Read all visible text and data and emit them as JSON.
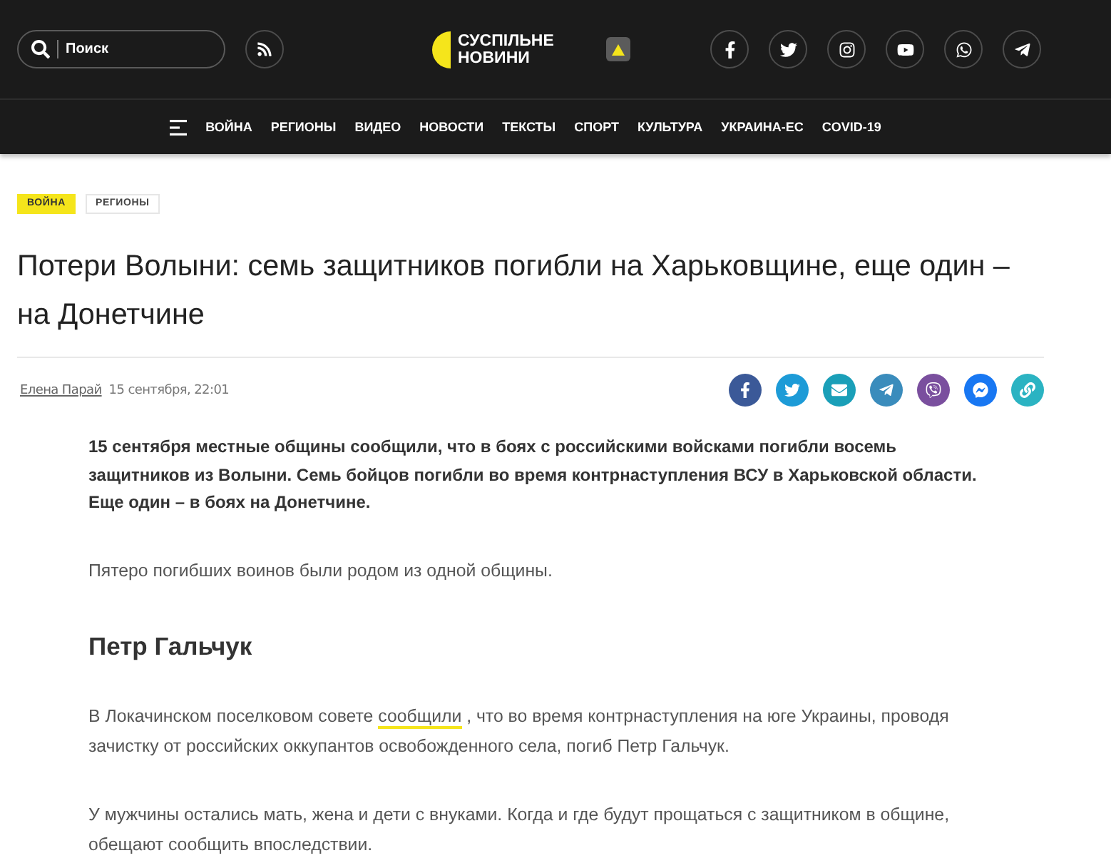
{
  "header": {
    "search": {
      "placeholder": "Поиск"
    },
    "logo": {
      "line_1": "СУСПІЛЬНЕ",
      "line_2": "НОВИНИ"
    }
  },
  "nav": {
    "items": [
      {
        "label": "ВОЙНА"
      },
      {
        "label": "РЕГИОНЫ"
      },
      {
        "label": "ВИДЕО"
      },
      {
        "label": "НОВОСТИ"
      },
      {
        "label": "ТЕКСТЫ"
      },
      {
        "label": "СПОРТ"
      },
      {
        "label": "КУЛЬТУРА"
      },
      {
        "label": "УКРАИНА-ЕС"
      },
      {
        "label": "COVID-19"
      }
    ]
  },
  "article": {
    "tags": [
      {
        "label": "ВОЙНА",
        "selected": true
      },
      {
        "label": "РЕГИОНЫ",
        "selected": false
      }
    ],
    "title": "Потери Волыни: семь защитников погибли на Харьковщине, еще один – на Донетчине",
    "author": "Елена Парай",
    "date": "15 сентября, 22:01",
    "blocks": [
      {
        "kind": "lead",
        "text": "15 сентября местные общины сообщили, что в боях с российскими войсками погибли восемь защитников из Волыни. Семь бойцов погибли во время контрнаступления ВСУ в Харьковской области. Еще один – в боях на Донетчине."
      },
      {
        "kind": "paragraph",
        "text": "Пятеро погибших воинов были родом из одной общины."
      },
      {
        "kind": "heading",
        "text": "Петр Гальчук"
      },
      {
        "kind": "linked_paragraph",
        "text_before": "В Локачинском поселковом совете",
        "link": "сообщили",
        "text_after": ", что во время контрнаступления на юге Украины, проводя зачистку от российских оккупантов освобожденного села, погиб Петр Гальчук."
      },
      {
        "kind": "paragraph",
        "text": "У мужчины остались мать, жена и дети с внуками. Когда и где будут прощаться с защитником в общине, обещают сообщить впоследствии."
      }
    ]
  }
}
